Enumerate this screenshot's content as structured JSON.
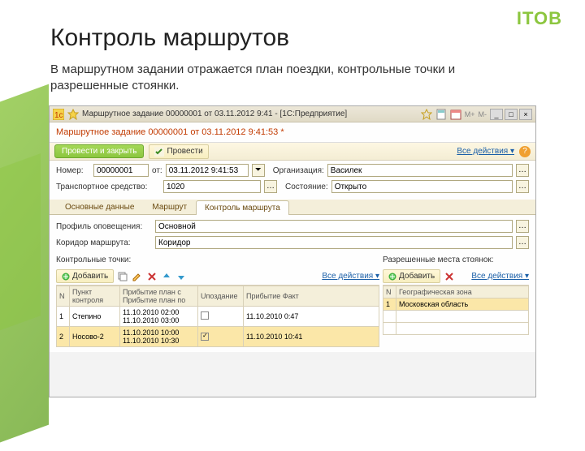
{
  "brand": "ITOB",
  "title": "Контроль маршрутов",
  "subtitle": "В маршрутном задании отражается план поездки, контрольные точки и разрешенные стоянки.",
  "window": {
    "title": "Маршрутное задание 00000001 от 03.11.2012 9:41 - [1С:Предприятие]",
    "mplus": "M+",
    "mminus": "M-",
    "min": "_",
    "max": "□",
    "close": "×"
  },
  "doc_title": "Маршрутное задание 00000001 от 03.11.2012 9:41:53 *",
  "cmdbar": {
    "save_close": "Провести и закрыть",
    "save": "Провести",
    "all_actions": "Все действия ▾"
  },
  "fields": {
    "number_lbl": "Номер:",
    "number_val": "00000001",
    "date_lbl": "от:",
    "date_val": "03.11.2012 9:41:53",
    "org_lbl": "Организация:",
    "org_val": "Василек",
    "vehicle_lbl": "Транспортное средство:",
    "vehicle_val": "1020",
    "state_lbl": "Состояние:",
    "state_val": "Открыто"
  },
  "tabs": [
    "Основные данные",
    "Маршрут",
    "Контроль маршрута"
  ],
  "tab_active": 2,
  "ctrl": {
    "profile_lbl": "Профиль оповещения:",
    "profile_val": "Основной",
    "corridor_lbl": "Коридор маршрута:",
    "corridor_val": "Коридор",
    "left_section": "Контрольные точки:",
    "right_section": "Разрешенные места стоянок:"
  },
  "toolbar": {
    "add": "Добавить",
    "all_actions": "Все действия ▾"
  },
  "left_cols": [
    "N",
    "Пункт контроля",
    "Прибытие план с\nПрибытие план по",
    "Uпоздание",
    "Прибытие Факт"
  ],
  "left_rows": [
    {
      "n": "1",
      "point": "Степино",
      "arr1": "11.10.2010 02:00",
      "arr2": "11.10.2010 03:00",
      "late": false,
      "fact": "11.10.2010 0:47"
    },
    {
      "n": "2",
      "point": "Носово-2",
      "arr1": "11.10.2010 10:00",
      "arr2": "11.10.2010 10:30",
      "late": true,
      "fact": "11.10.2010 10:41"
    }
  ],
  "right_cols": [
    "N",
    "Географическая зона"
  ],
  "right_rows": [
    {
      "n": "1",
      "zone": "Московская область"
    }
  ]
}
